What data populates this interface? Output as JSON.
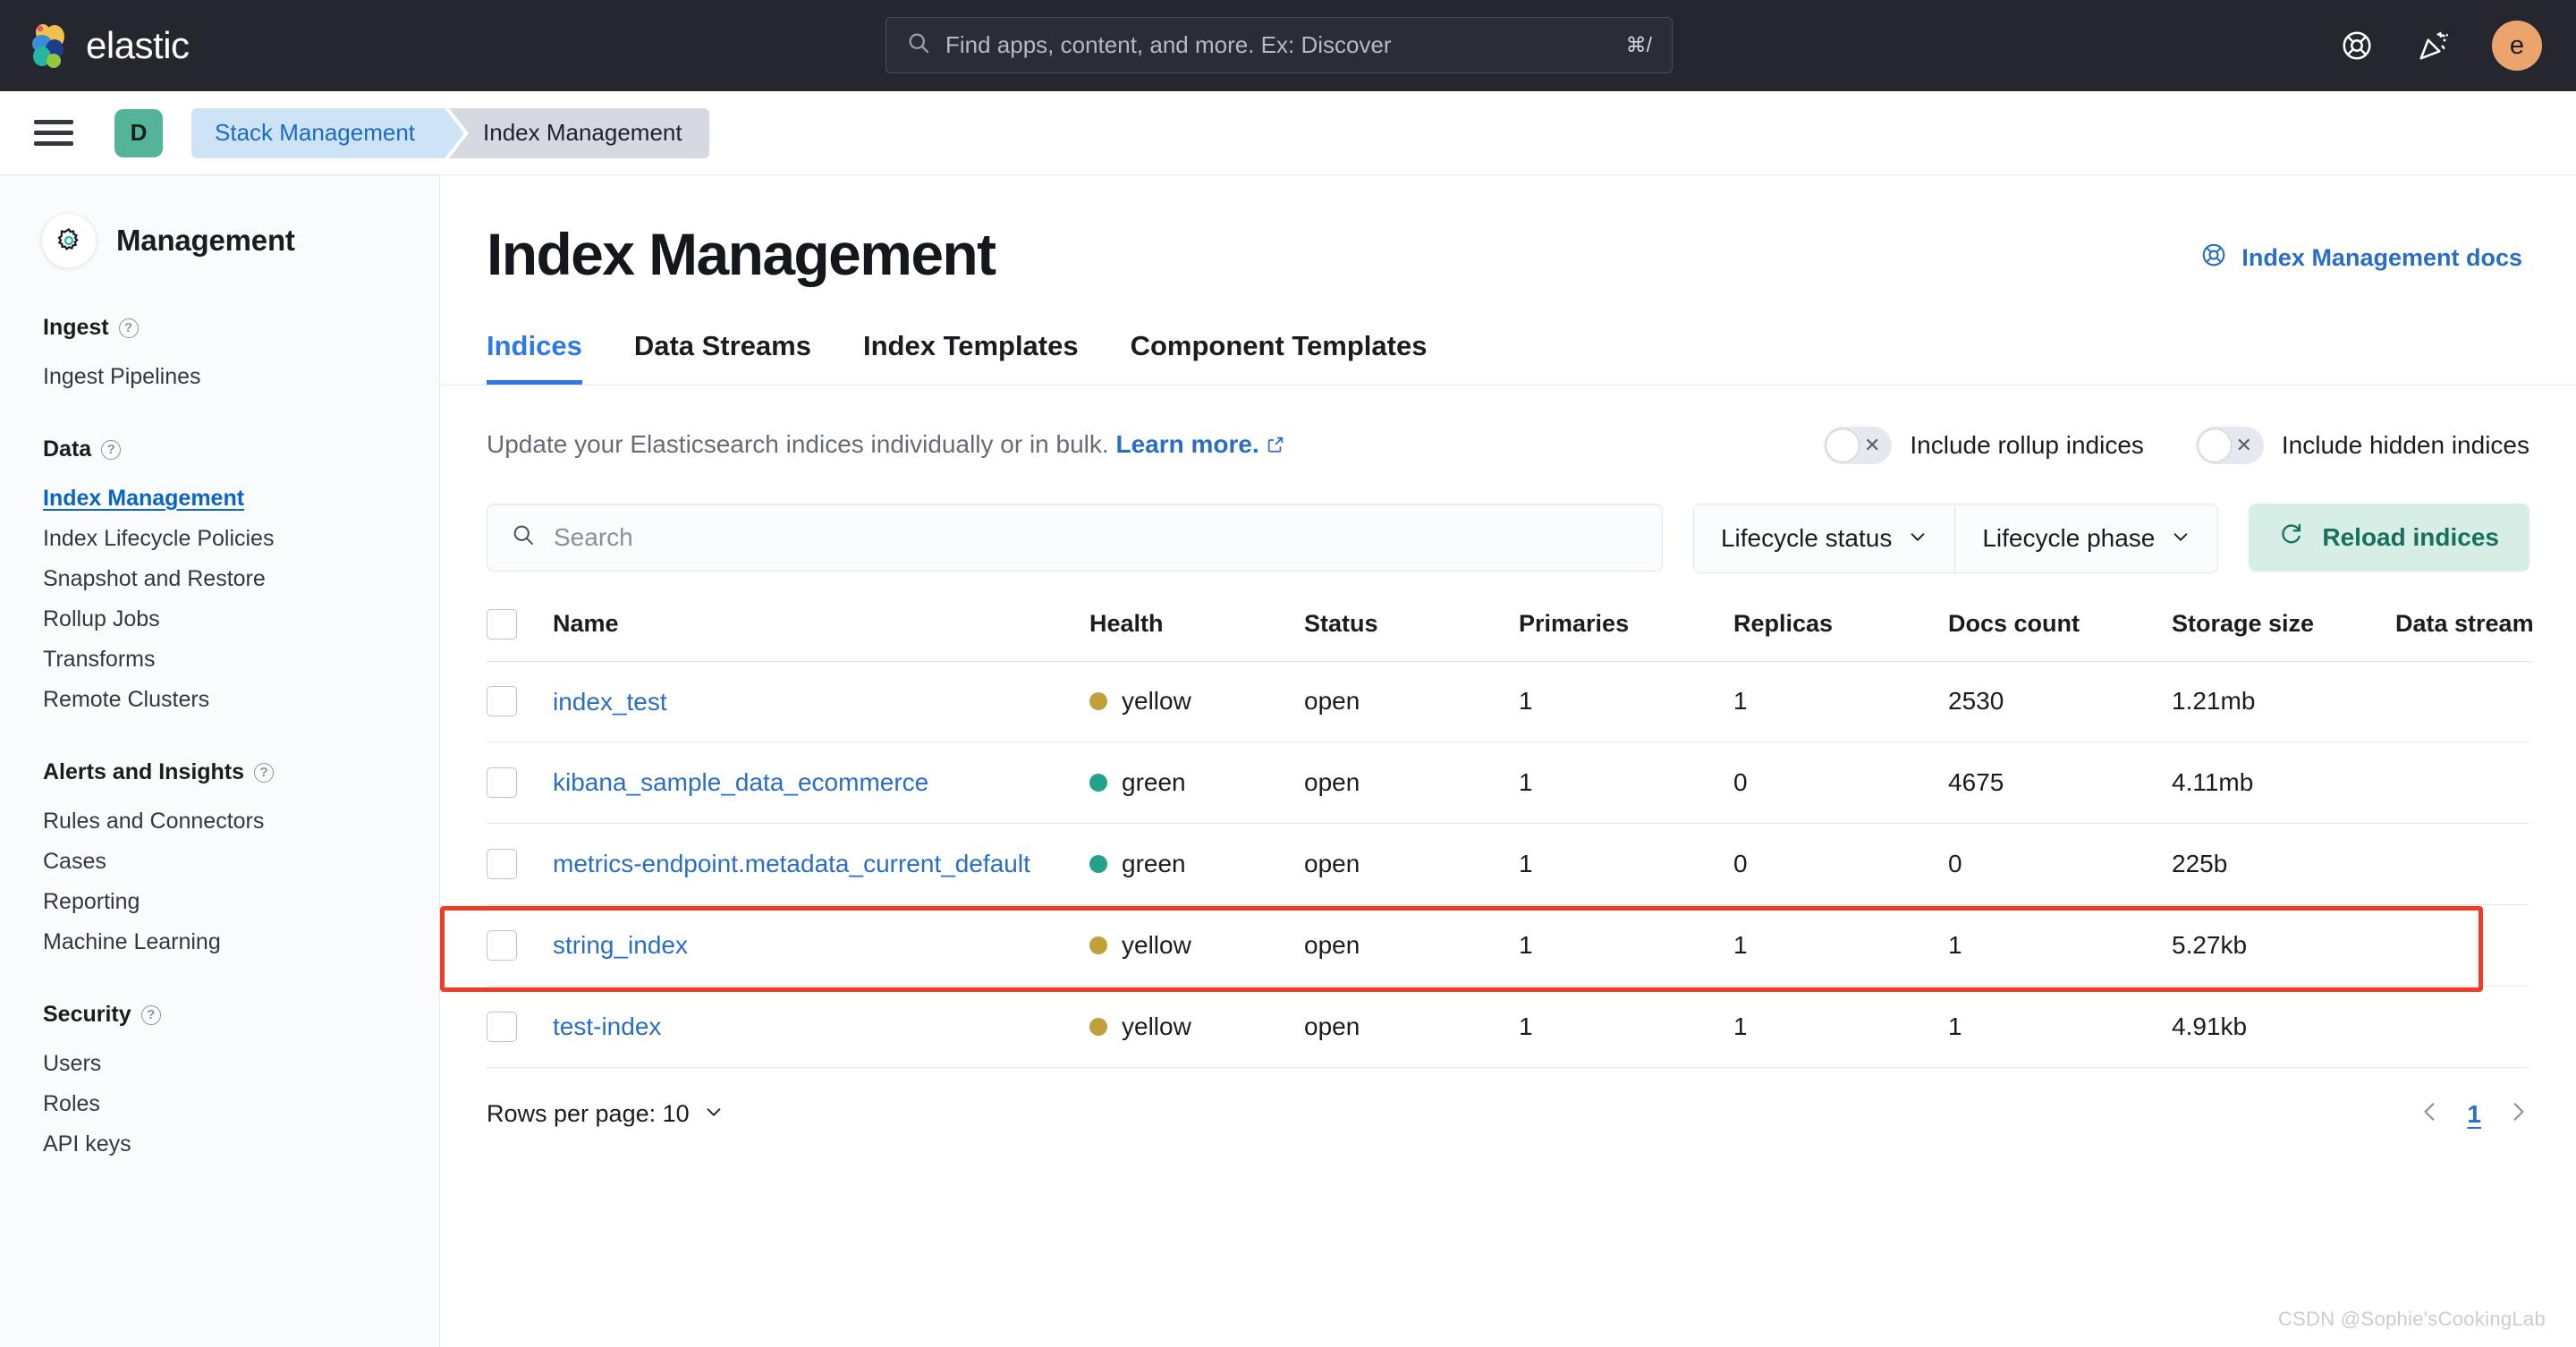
{
  "header": {
    "brand_name": "elastic",
    "search": {
      "placeholder": "Find apps, content, and more. Ex: Discover",
      "shortcut": "⌘/",
      "icon": "search-icon"
    },
    "help_icon": "help-lifebuoy-icon",
    "whats_new_icon": "party-popper-icon",
    "avatar_initial": "e",
    "avatar_color": "#eba46c",
    "background_color": "#25262e"
  },
  "breadcrumb": {
    "menu_icon": "hamburger-menu-icon",
    "space_initial": "D",
    "space_color": "#54b399",
    "items": [
      {
        "label": "Stack Management",
        "current": false
      },
      {
        "label": "Index Management",
        "current": true
      }
    ]
  },
  "sidebar": {
    "title": "Management",
    "icon": "gear-icon",
    "groups": [
      {
        "title": "Ingest",
        "help_icon": "question-circle-icon",
        "items": [
          {
            "label": "Ingest Pipelines",
            "active": false
          }
        ]
      },
      {
        "title": "Data",
        "help_icon": "question-circle-icon",
        "items": [
          {
            "label": "Index Management",
            "active": true
          },
          {
            "label": "Index Lifecycle Policies",
            "active": false
          },
          {
            "label": "Snapshot and Restore",
            "active": false
          },
          {
            "label": "Rollup Jobs",
            "active": false
          },
          {
            "label": "Transforms",
            "active": false
          },
          {
            "label": "Remote Clusters",
            "active": false
          }
        ]
      },
      {
        "title": "Alerts and Insights",
        "help_icon": "question-circle-icon",
        "items": [
          {
            "label": "Rules and Connectors",
            "active": false
          },
          {
            "label": "Cases",
            "active": false
          },
          {
            "label": "Reporting",
            "active": false
          },
          {
            "label": "Machine Learning",
            "active": false
          }
        ]
      },
      {
        "title": "Security",
        "help_icon": "question-circle-icon",
        "items": [
          {
            "label": "Users",
            "active": false
          },
          {
            "label": "Roles",
            "active": false
          },
          {
            "label": "API keys",
            "active": false
          }
        ]
      }
    ]
  },
  "main": {
    "page_title": "Index Management",
    "docs_link": {
      "label": "Index Management docs",
      "icon": "help-lifebuoy-icon"
    },
    "tabs": [
      {
        "label": "Indices",
        "active": true
      },
      {
        "label": "Data Streams",
        "active": false
      },
      {
        "label": "Index Templates",
        "active": false
      },
      {
        "label": "Component Templates",
        "active": false
      }
    ],
    "description": {
      "text": "Update your Elasticsearch indices individually or in bulk. ",
      "link_label": "Learn more.",
      "link_icon": "external-link-icon"
    },
    "toggles": [
      {
        "label": "Include rollup indices",
        "checked": false,
        "glyph": "✕"
      },
      {
        "label": "Include hidden indices",
        "checked": false,
        "glyph": "✕"
      }
    ],
    "search": {
      "placeholder": "Search",
      "value": "",
      "icon": "search-icon"
    },
    "filters": [
      {
        "label": "Lifecycle status",
        "icon": "chevron-down-icon"
      },
      {
        "label": "Lifecycle phase",
        "icon": "chevron-down-icon"
      }
    ],
    "reload_button": {
      "label": "Reload indices",
      "icon": "refresh-icon",
      "color": "#17705b",
      "background": "#d7eee7"
    },
    "table": {
      "columns": [
        "Name",
        "Health",
        "Status",
        "Primaries",
        "Replicas",
        "Docs count",
        "Storage size",
        "Data stream"
      ],
      "rows": [
        {
          "name": "index_test",
          "health": "yellow",
          "health_color": "#c0a139",
          "status": "open",
          "primaries": "1",
          "replicas": "1",
          "docs_count": "2530",
          "storage_size": "1.21mb",
          "data_stream": "",
          "highlighted": false
        },
        {
          "name": "kibana_sample_data_ecommerce",
          "health": "green",
          "health_color": "#24a18b",
          "status": "open",
          "primaries": "1",
          "replicas": "0",
          "docs_count": "4675",
          "storage_size": "4.11mb",
          "data_stream": "",
          "highlighted": false
        },
        {
          "name": "metrics-endpoint.metadata_current_default",
          "health": "green",
          "health_color": "#24a18b",
          "status": "open",
          "primaries": "1",
          "replicas": "0",
          "docs_count": "0",
          "storage_size": "225b",
          "data_stream": "",
          "highlighted": false
        },
        {
          "name": "string_index",
          "health": "yellow",
          "health_color": "#c0a139",
          "status": "open",
          "primaries": "1",
          "replicas": "1",
          "docs_count": "1",
          "storage_size": "5.27kb",
          "data_stream": "",
          "highlighted": false
        },
        {
          "name": "test-index",
          "health": "yellow",
          "health_color": "#c0a139",
          "status": "open",
          "primaries": "1",
          "replicas": "1",
          "docs_count": "1",
          "storage_size": "4.91kb",
          "data_stream": "",
          "highlighted": true
        }
      ],
      "highlight_color": "#ee3d22"
    },
    "pagination": {
      "rows_per_page_label": "Rows per page: 10",
      "rows_per_page_icon": "chevron-down-icon",
      "prev_icon": "chevron-left-icon",
      "next_icon": "chevron-right-icon",
      "current_page": "1"
    }
  },
  "watermark": "CSDN @Sophie'sCookingLab"
}
